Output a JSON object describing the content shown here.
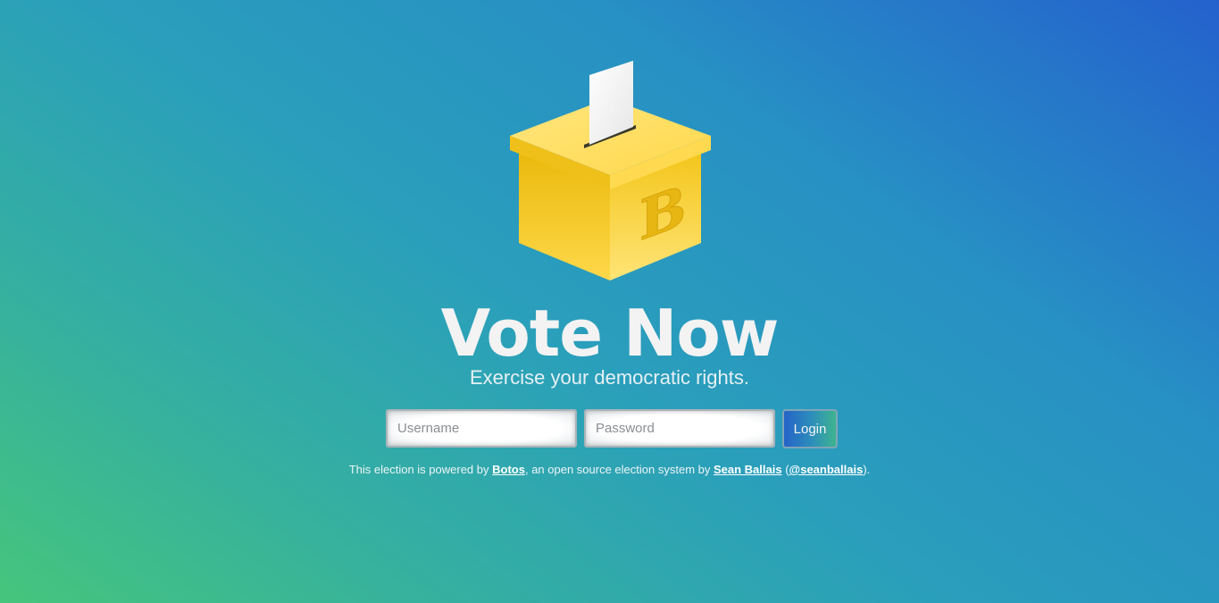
{
  "hero": {
    "title": "Vote Now",
    "subtitle": "Exercise your democratic rights."
  },
  "login_form": {
    "username_placeholder": "Username",
    "password_placeholder": "Password",
    "username_value": "",
    "password_value": "",
    "login_label": "Login"
  },
  "footer": {
    "text_1": "This election is powered by ",
    "link_botos": "Botos",
    "text_2": ", an open source election system by ",
    "link_author": "Sean Ballais",
    "text_3": " (",
    "link_handle": "@seanballais",
    "text_4": ")."
  },
  "logo": {
    "icon": "ballot-box-icon",
    "letter": "B"
  },
  "colors": {
    "background_start": "#46c57c",
    "background_end": "#2461cd",
    "box_yellow": "#ffd84a",
    "text": "#f2f2f2"
  }
}
